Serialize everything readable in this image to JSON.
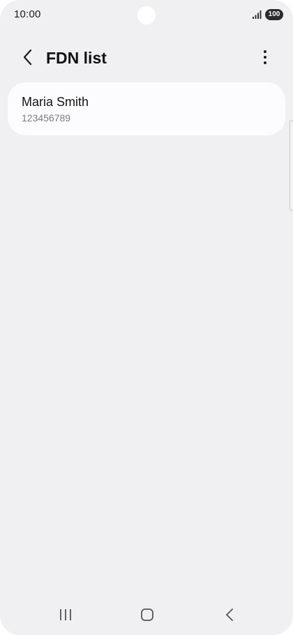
{
  "status_bar": {
    "time": "10:00",
    "battery_level": "100",
    "icons": [
      "signal-icon",
      "battery-icon"
    ]
  },
  "header": {
    "title": "FDN list",
    "icons": [
      "back-arrow-icon",
      "more-options-icon"
    ]
  },
  "fdn_list": {
    "items": [
      {
        "name": "Maria Smith",
        "number": "123456789"
      }
    ]
  },
  "navigation_bar": {
    "icons": [
      "recent-apps-icon",
      "home-icon",
      "back-icon"
    ]
  },
  "colors": {
    "background": "#f0f0f3",
    "card": "#fcfcfe",
    "primary_text": "#141414",
    "secondary_text": "#7d7d7d"
  }
}
